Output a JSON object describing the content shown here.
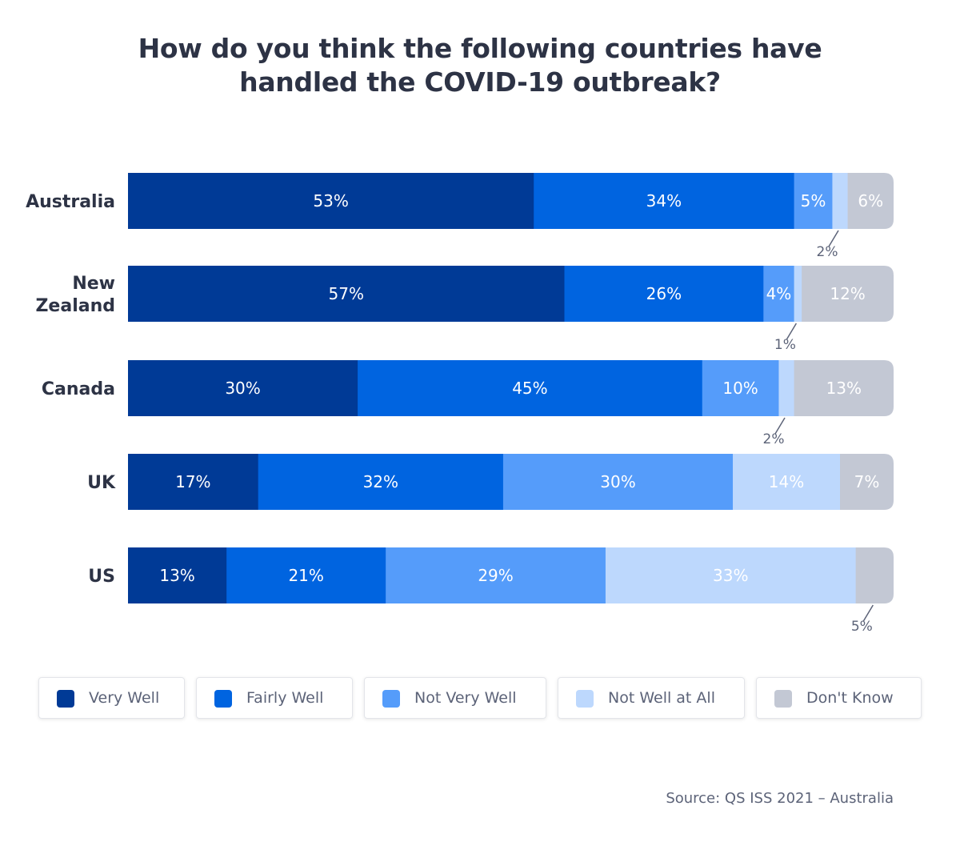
{
  "chart_data": {
    "type": "bar",
    "orientation": "horizontal",
    "stacked": true,
    "title": "How do you think the following countries have handled the COVID-19 outbreak?",
    "title_lines": [
      "How do you think the following countries have",
      "handled the COVID-19 outbreak?"
    ],
    "categories": [
      "Australia",
      "New Zealand",
      "Canada",
      "UK",
      "US"
    ],
    "category_label_lines": [
      [
        "Australia"
      ],
      [
        "New",
        "Zealand"
      ],
      [
        "Canada"
      ],
      [
        "UK"
      ],
      [
        "US"
      ]
    ],
    "series": [
      {
        "name": "Very Well",
        "color": "#003a96",
        "values": [
          53,
          57,
          30,
          17,
          13
        ]
      },
      {
        "name": "Fairly Well",
        "color": "#0064e0",
        "values": [
          34,
          26,
          45,
          32,
          21
        ]
      },
      {
        "name": "Not Very Well",
        "color": "#559cfa",
        "values": [
          5,
          4,
          10,
          30,
          29
        ]
      },
      {
        "name": "Not Well at All",
        "color": "#bdd8fd",
        "values": [
          2,
          1,
          2,
          14,
          33
        ]
      },
      {
        "name": "Don't Know",
        "color": "#c3c8d4",
        "values": [
          6,
          12,
          13,
          7,
          5
        ]
      }
    ],
    "value_suffix": "%",
    "external_labels": [
      {
        "category": "Australia",
        "series": "Not Well at All"
      },
      {
        "category": "New Zealand",
        "series": "Not Well at All"
      },
      {
        "category": "Canada",
        "series": "Not Well at All"
      },
      {
        "category": "US",
        "series": "Don't Know"
      }
    ],
    "xlabel": "",
    "ylabel": "",
    "grid": false,
    "legend_position": "bottom"
  },
  "source": "Source: QS ISS 2021 – Australia"
}
